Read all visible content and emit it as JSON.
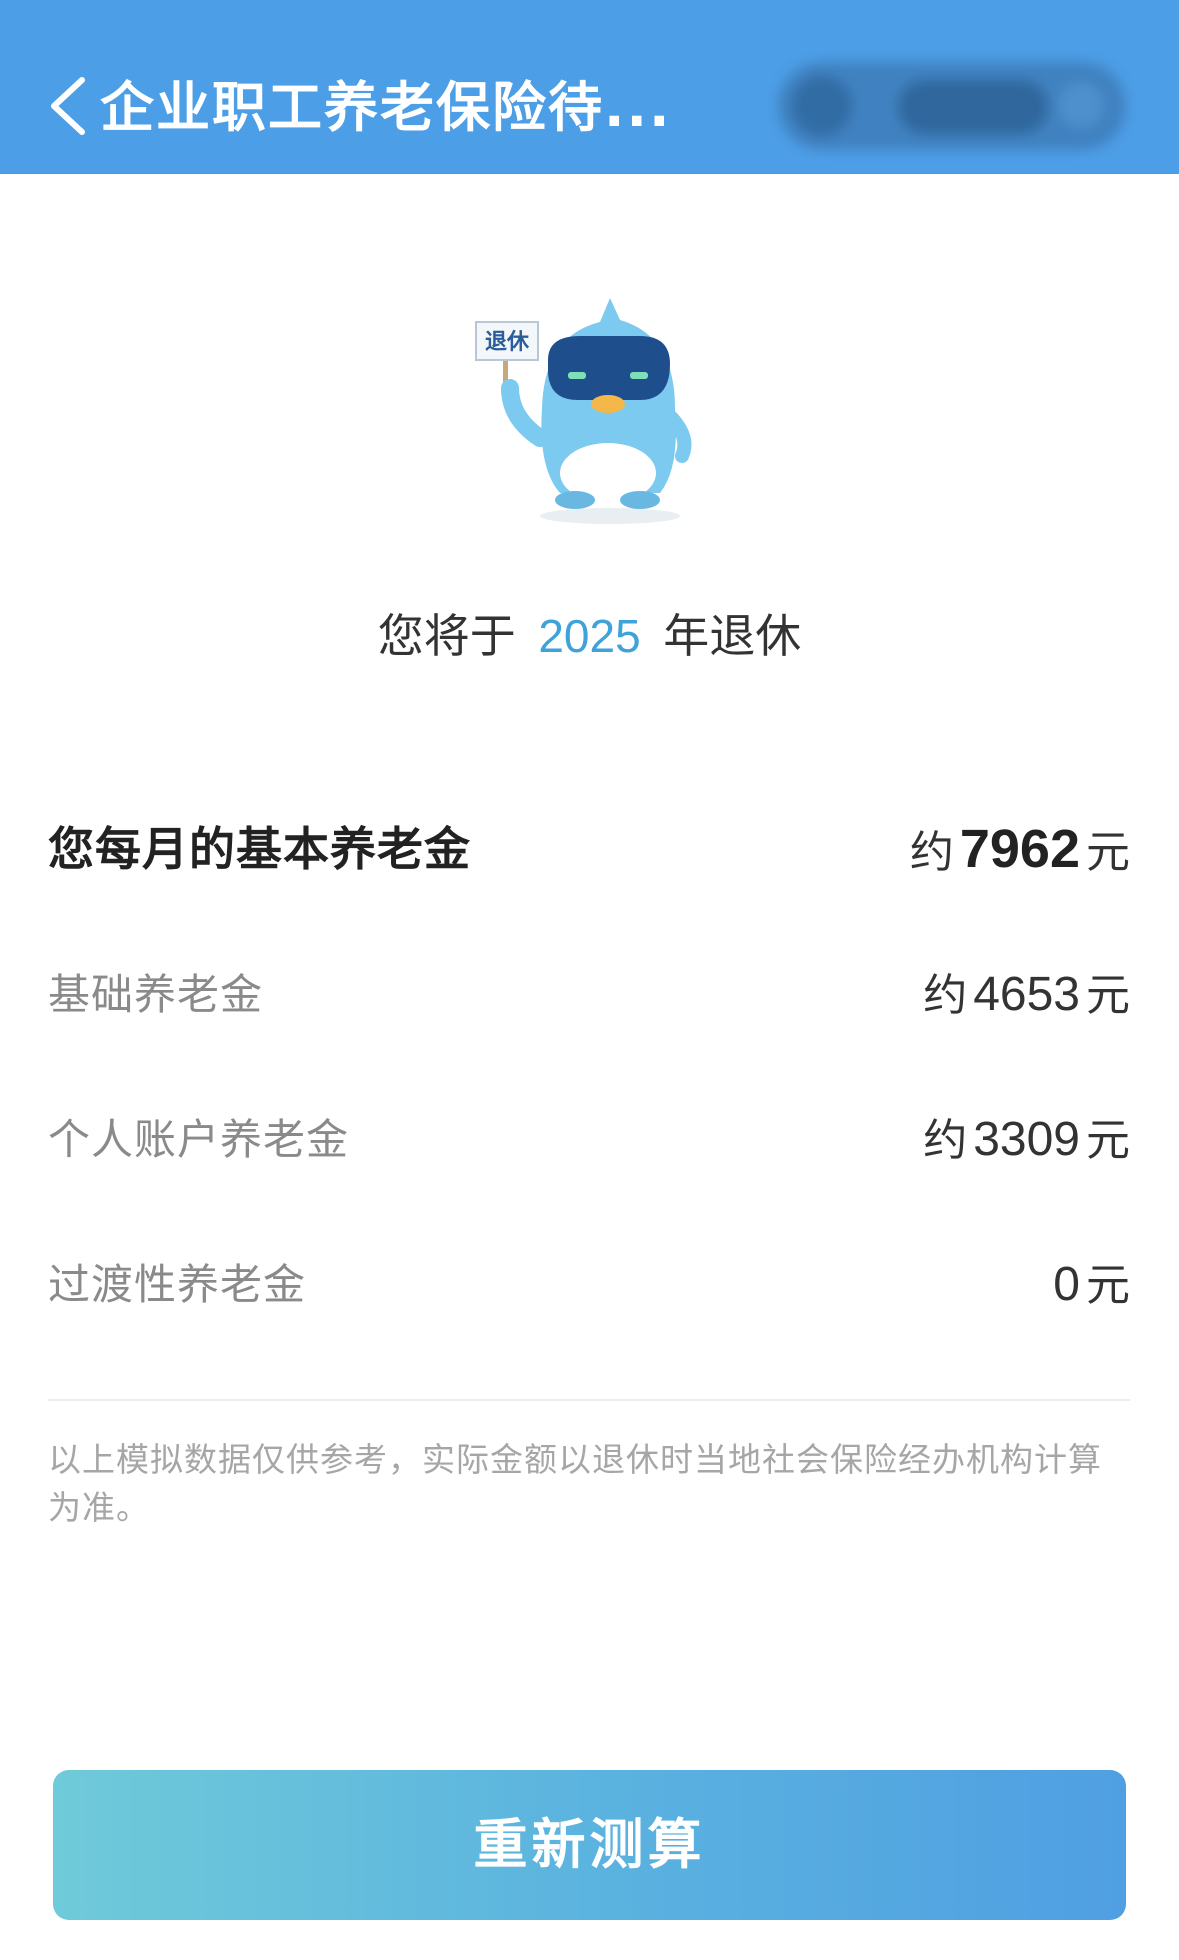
{
  "header": {
    "title": "企业职工养老保险待...",
    "back_icon": "chevron-left-icon",
    "capsule": "blurred-menu-capsule"
  },
  "hero": {
    "mascot_sign": "退休",
    "retire_prefix": "您将于",
    "retire_year": "2025",
    "retire_suffix": "年退休"
  },
  "pension": {
    "total": {
      "label": "您每月的基本养老金",
      "prefix": "约",
      "amount": "7962",
      "unit": "元"
    },
    "items": [
      {
        "label": "基础养老金",
        "prefix": "约",
        "amount": "4653",
        "unit": "元"
      },
      {
        "label": "个人账户养老金",
        "prefix": "约",
        "amount": "3309",
        "unit": "元"
      },
      {
        "label": "过渡性养老金",
        "prefix": "",
        "amount": "0",
        "unit": "元"
      }
    ]
  },
  "note": "以上模拟数据仅供参考，实际金额以退休时当地社会保险经办机构计算为准。",
  "actions": {
    "recalc_label": "重新测算"
  },
  "colors": {
    "header": "#4c9ee6",
    "accent": "#3fa2d9",
    "button_start": "#6fcad9",
    "button_end": "#4f9fe2"
  }
}
